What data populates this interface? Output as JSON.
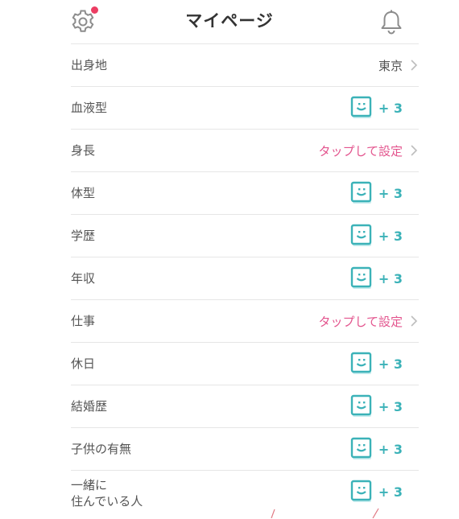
{
  "header": {
    "title": "マイページ",
    "settings_icon": "gear-icon",
    "bell_icon": "bell-icon",
    "badge_color": "#ec3d63"
  },
  "colors": {
    "accent_teal": "#3bb2b8",
    "tap_pink": "#e3558e"
  },
  "rows": [
    {
      "label": "出身地",
      "type": "value",
      "value": "東京"
    },
    {
      "label": "血液型",
      "type": "badge",
      "badge": "+ 3"
    },
    {
      "label": "身長",
      "type": "tap",
      "value": "タップして設定"
    },
    {
      "label": "体型",
      "type": "badge",
      "badge": "+ 3"
    },
    {
      "label": "学歴",
      "type": "badge",
      "badge": "+ 3"
    },
    {
      "label": "年収",
      "type": "badge",
      "badge": "+ 3"
    },
    {
      "label": "仕事",
      "type": "tap",
      "value": "タップして設定"
    },
    {
      "label": "休日",
      "type": "badge",
      "badge": "+ 3"
    },
    {
      "label": "結婚歴",
      "type": "badge",
      "badge": "+ 3"
    },
    {
      "label": "子供の有無",
      "type": "badge",
      "badge": "+ 3"
    },
    {
      "label_line1": "一緒に",
      "label_line2": "住んでいる人",
      "type": "badge",
      "badge": "+ 3"
    }
  ]
}
